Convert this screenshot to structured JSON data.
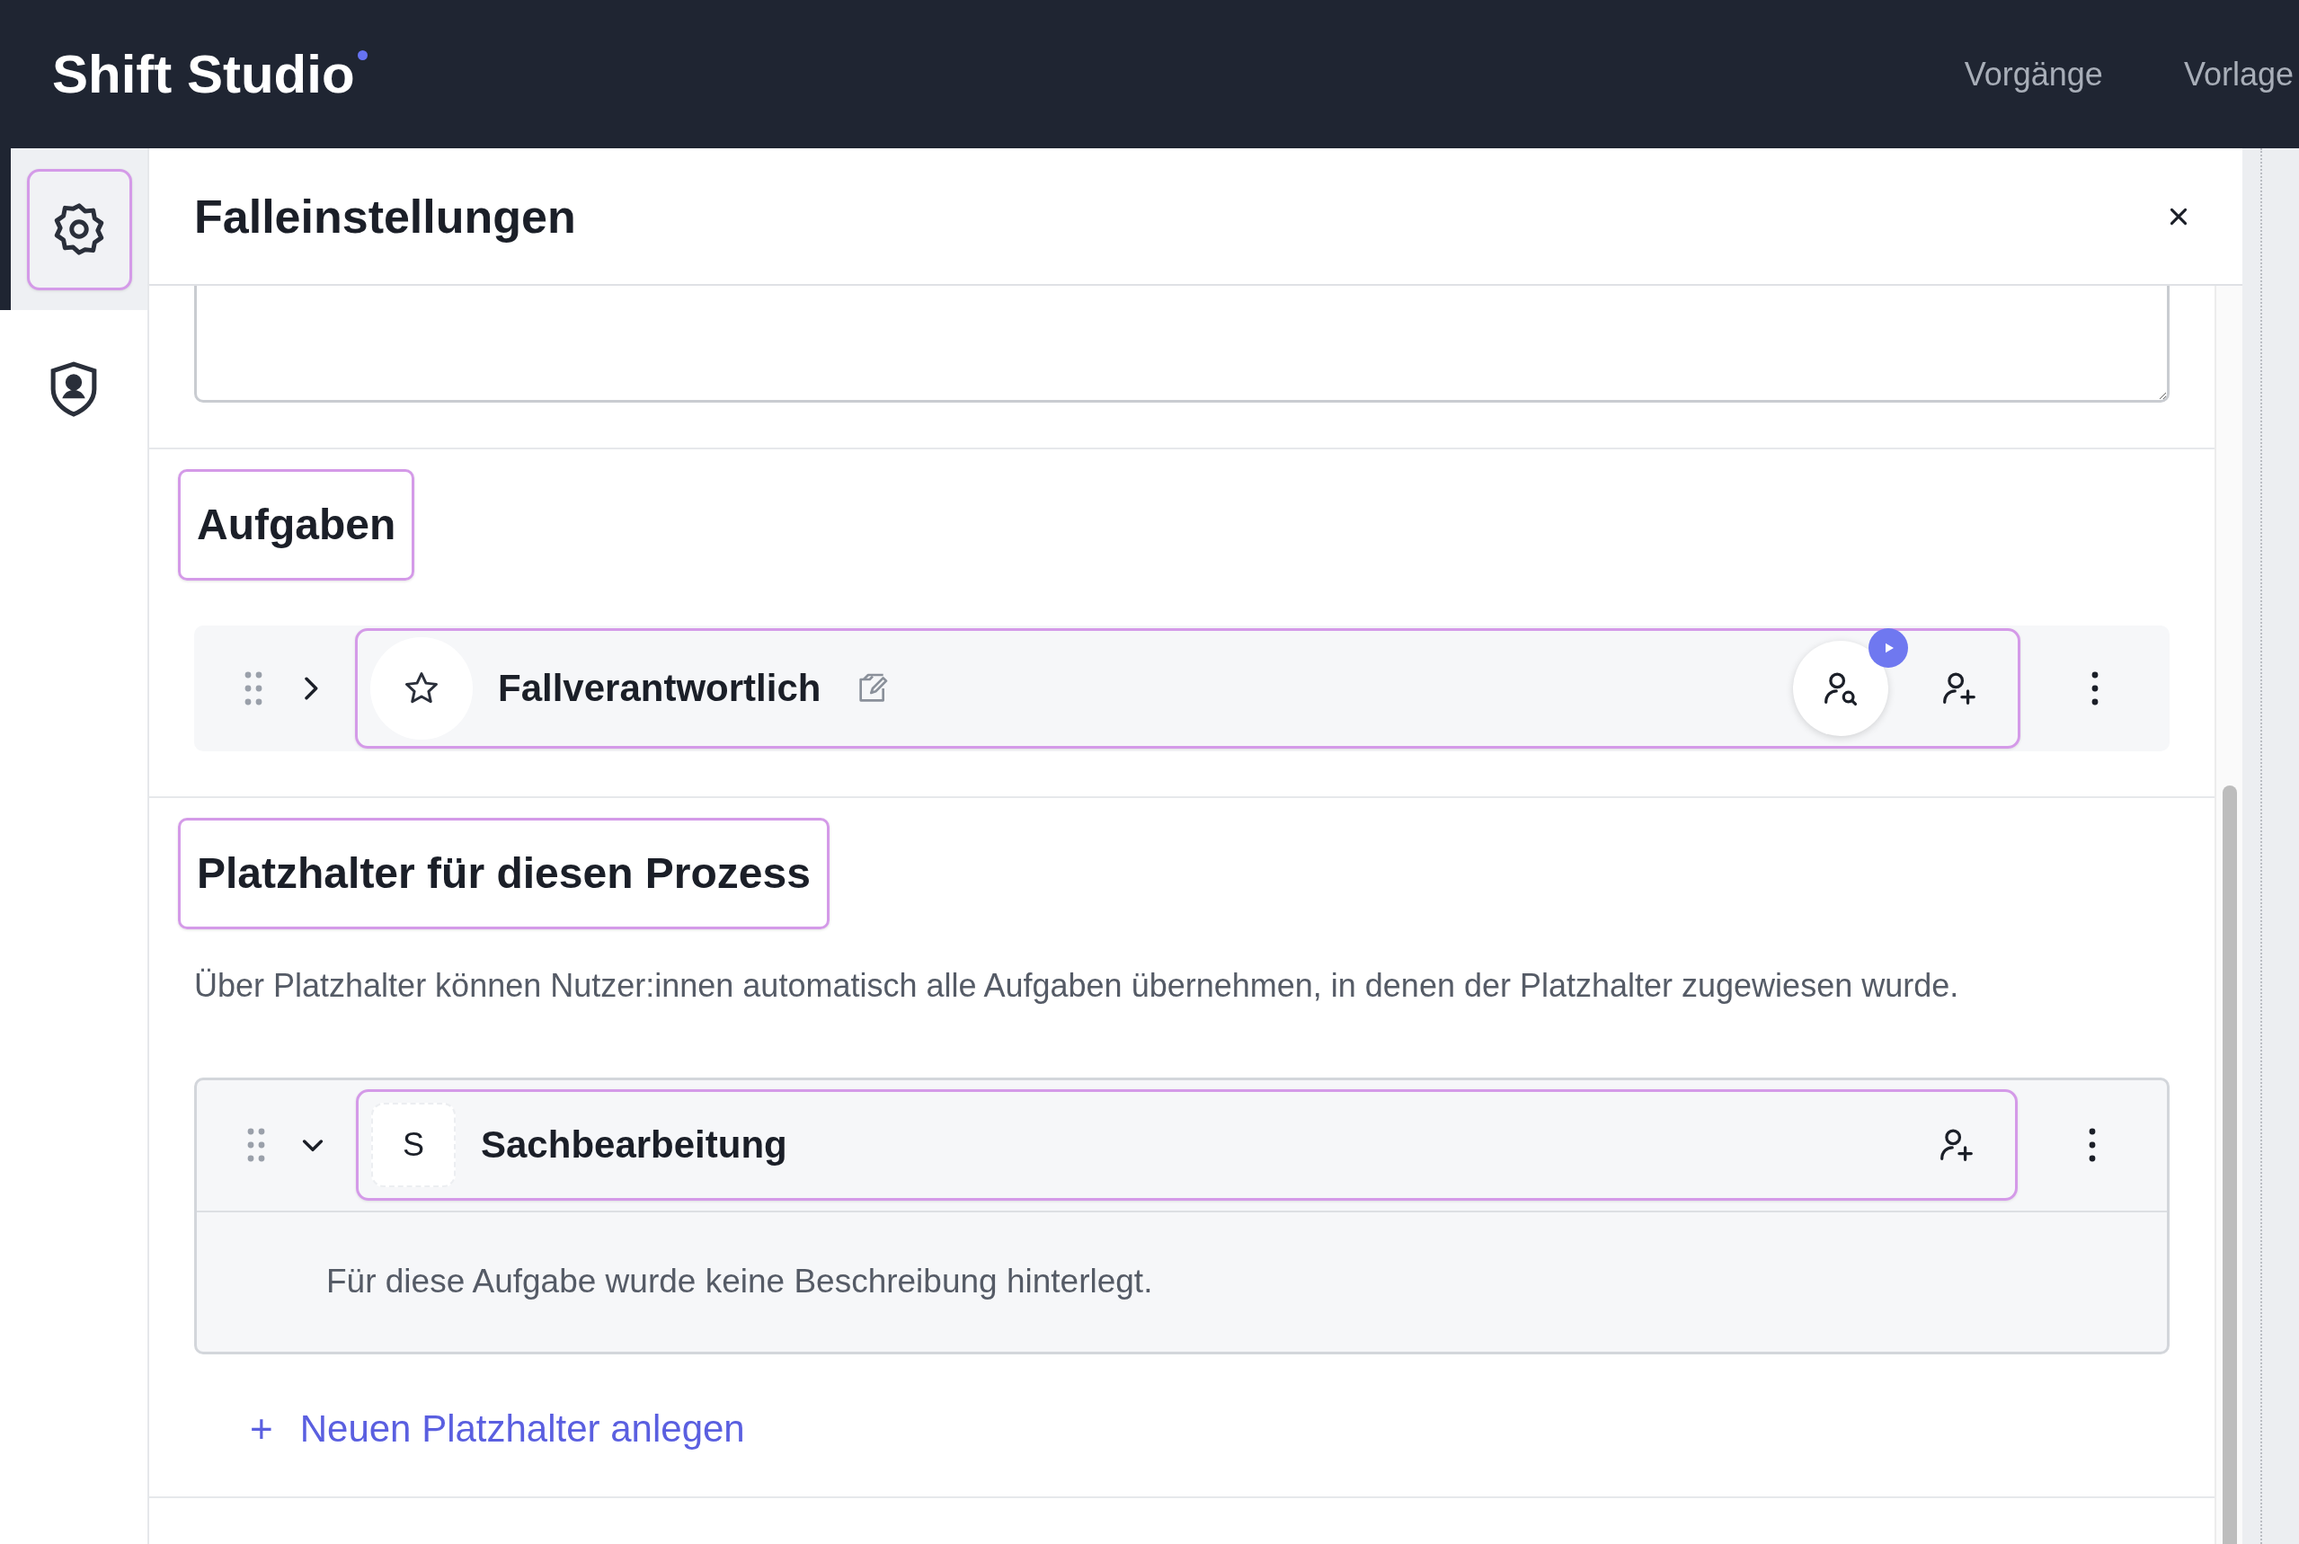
{
  "header": {
    "brand": "Shift Studio",
    "nav": [
      {
        "label": "Vorgänge"
      },
      {
        "label": "Vorlage"
      }
    ]
  },
  "sidebar": {
    "items": [
      {
        "kind": "settings",
        "selected": true
      },
      {
        "kind": "role",
        "selected": false
      }
    ]
  },
  "panel": {
    "title": "Falleinstellungen",
    "tasks_section": {
      "heading": "Aufgaben",
      "highlighted": true,
      "tasks": [
        {
          "title": "Fallverantwortlich",
          "expanded": false,
          "highlighted": true,
          "editable": true,
          "assign_running": true
        }
      ]
    },
    "placeholders_section": {
      "heading": "Platzhalter für diesen Prozess",
      "highlighted": true,
      "description": "Über Platzhalter können Nutzer:innen automatisch alle Aufgaben übernehmen, in denen der Platzhalter zugewiesen wurde.",
      "placeholders": [
        {
          "initial": "S",
          "title": "Sachbearbeitung",
          "expanded": true,
          "highlighted": true,
          "body": "Für diese Aufgabe wurde keine Beschreibung hinterlegt."
        }
      ],
      "add_label": "Neuen Platzhalter anlegen",
      "add_icon": "+"
    }
  }
}
